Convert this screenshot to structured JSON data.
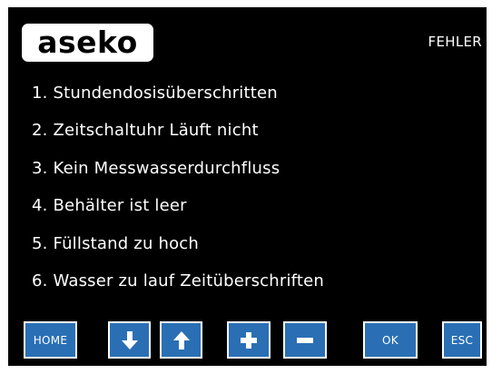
{
  "header": {
    "logo_text": "aseko",
    "screen_title": "FEHLER"
  },
  "errors": [
    "1. Stundendosisüberschritten",
    "2. Zeitschaltuhr Läuft nicht",
    "3. Kein Messwasserdurchfluss",
    "4. Behälter ist leer",
    "5. Füllstand zu hoch",
    "6. Wasser zu lauf Zeitüberschriften"
  ],
  "buttons": {
    "home_label": "HOME",
    "down_icon": "arrow-down-icon",
    "up_icon": "arrow-up-icon",
    "plus_icon": "plus-icon",
    "minus_icon": "minus-icon",
    "ok_label": "OK",
    "esc_label": "ESC"
  },
  "colors": {
    "screen_background": "#000000",
    "text": "#ffffff",
    "button_fill": "#2a6fb4",
    "button_border": "#ffffff"
  }
}
